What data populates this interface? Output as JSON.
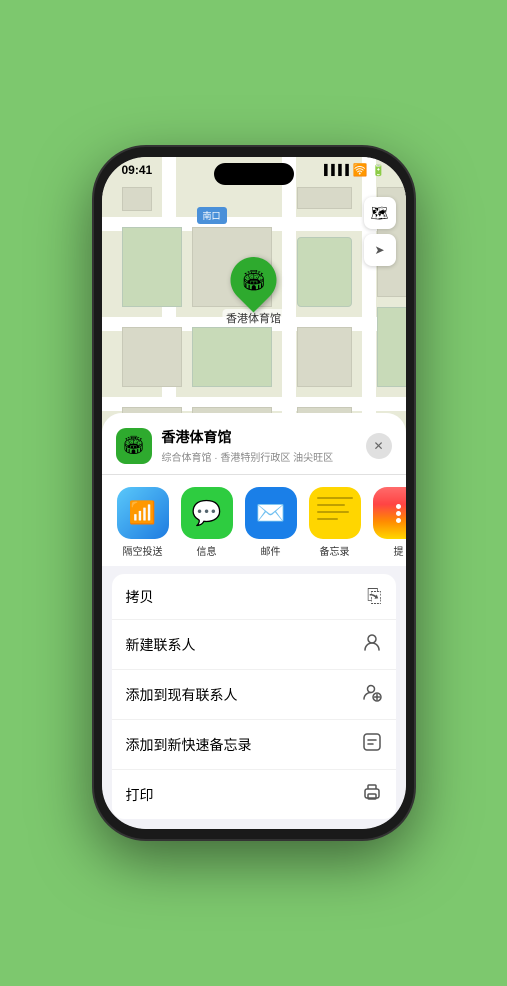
{
  "device": {
    "time": "09:41",
    "bg_color": "#7dc86e"
  },
  "map": {
    "label_nankou": "南口",
    "venue_marker": "香港体育馆"
  },
  "controls": {
    "map_icon": "🗺",
    "location_icon": "➤"
  },
  "venue_card": {
    "name": "香港体育馆",
    "subtitle": "综合体育馆 · 香港特别行政区 油尖旺区",
    "close_label": "✕"
  },
  "share_apps": [
    {
      "id": "airdrop",
      "label": "隔空投送",
      "type": "airdrop",
      "selected": false
    },
    {
      "id": "messages",
      "label": "信息",
      "type": "messages",
      "selected": false
    },
    {
      "id": "mail",
      "label": "邮件",
      "type": "mail",
      "selected": false
    },
    {
      "id": "notes",
      "label": "备忘录",
      "type": "notes",
      "selected": true
    },
    {
      "id": "more",
      "label": "提",
      "type": "more",
      "selected": false
    }
  ],
  "action_items": [
    {
      "id": "copy",
      "label": "拷贝",
      "icon": "⎘"
    },
    {
      "id": "new-contact",
      "label": "新建联系人",
      "icon": "👤"
    },
    {
      "id": "add-existing",
      "label": "添加到现有联系人",
      "icon": "👤"
    },
    {
      "id": "add-notes",
      "label": "添加到新快速备忘录",
      "icon": "⊡"
    },
    {
      "id": "print",
      "label": "打印",
      "icon": "🖨"
    }
  ]
}
